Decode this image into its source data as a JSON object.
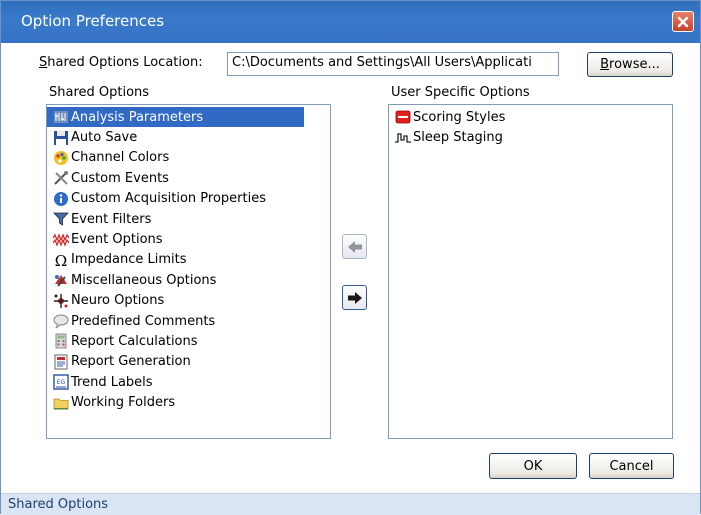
{
  "window": {
    "title": "Option Preferences"
  },
  "location": {
    "label_prefix": "S",
    "label_rest": "hared Options Location:",
    "value": "C:\\Documents and Settings\\All Users\\Applicati",
    "browse_prefix": "B",
    "browse_rest": "rowse..."
  },
  "shared": {
    "header": "Shared Options",
    "items": [
      {
        "label": "Analysis Parameters",
        "icon": "analysis-parameters-icon",
        "selected": true
      },
      {
        "label": "Auto Save",
        "icon": "floppy-disk-icon"
      },
      {
        "label": "Channel Colors",
        "icon": "color-palette-icon"
      },
      {
        "label": "Custom Events",
        "icon": "tools-icon"
      },
      {
        "label": "Custom Acquisition Properties",
        "icon": "info-icon"
      },
      {
        "label": "Event Filters",
        "icon": "funnel-icon"
      },
      {
        "label": "Event Options",
        "icon": "waveform-icon"
      },
      {
        "label": "Impedance Limits",
        "icon": "omega-icon"
      },
      {
        "label": "Miscellaneous Options",
        "icon": "misc-options-icon"
      },
      {
        "label": "Neuro Options",
        "icon": "neuro-icon"
      },
      {
        "label": "Predefined Comments",
        "icon": "speech-bubble-icon"
      },
      {
        "label": "Report Calculations",
        "icon": "calculator-icon"
      },
      {
        "label": "Report Generation",
        "icon": "report-icon"
      },
      {
        "label": "Trend Labels",
        "icon": "trend-labels-icon"
      },
      {
        "label": "Working Folders",
        "icon": "folder-icon"
      }
    ]
  },
  "user": {
    "header": "User Specific Options",
    "items": [
      {
        "label": "Scoring Styles",
        "icon": "scoring-styles-icon"
      },
      {
        "label": "Sleep Staging",
        "icon": "hypnogram-icon"
      }
    ]
  },
  "buttons": {
    "ok": "OK",
    "cancel": "Cancel"
  },
  "status": {
    "text": "Shared Options"
  },
  "colors": {
    "titlebar": "#3572c3",
    "selection": "#316ac5",
    "statusbar": "#d9e5f3"
  }
}
